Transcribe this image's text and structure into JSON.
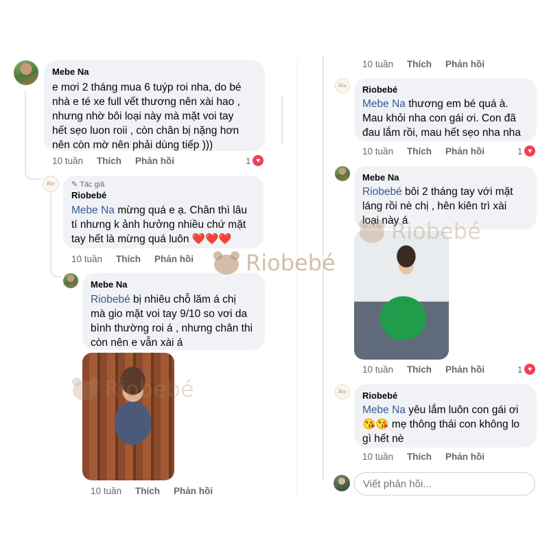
{
  "watermark": {
    "brand": "Riobebé"
  },
  "left": {
    "comment1": {
      "author": "Mebe Na",
      "text": "e mơi 2 tháng mua 6 tuýp roi nha, do bé\nnhà e té xe full vết thương nên xài hao ,\nnhưng nhờ bôi loại này mà mặt voi tay\nhết sẹo luon roii , còn chân bị nặng hơn\nnên còn mờ nên phải dùng tiếp )))",
      "time": "10 tuần",
      "like": "Thích",
      "reply": "Phản hồi",
      "reaction_count": "1"
    },
    "reply1": {
      "badge": "Tác giả",
      "author": "Riobebé",
      "mention": "Mebe Na",
      "text": " mừng quá e ạ. Chân thì lâu\ntí nhưng k ảnh hưởng nhiều chứ mặt\ntay hết là mừng quá luôn ❤️❤️❤️",
      "time": "10 tuần",
      "like": "Thích",
      "reply": "Phản hồi"
    },
    "reply2": {
      "author": "Mebe Na",
      "mention": "Riobebé",
      "text": " bị nhiêu chỗ lăm á chị\nmà gio mặt voi tay 9/10 so vơi da\nbình thường roi á , nhưng chân thi\ncòn nên e vẫn xài á",
      "time": "10 tuần",
      "like": "Thích",
      "reply": "Phản hồi"
    }
  },
  "right": {
    "top_actions": {
      "time": "10 tuần",
      "like": "Thích",
      "reply": "Phản hồi"
    },
    "reply3": {
      "author": "Riobebé",
      "mention": "Mebe Na",
      "text": " thương em bé quá à.\nMau khỏi nha con gái ơi. Con đã\nđau lắm rồi, mau hết sẹo nha nha",
      "time": "10 tuần",
      "like": "Thích",
      "reply": "Phản hồi",
      "reaction_count": "1"
    },
    "reply4": {
      "author": "Mebe Na",
      "mention": "Riobebé",
      "text": " bôi 2 tháng tay với mặt\nláng rồi nè chị , hên kiên trì xài\nloại này á",
      "time": "10 tuần",
      "like": "Thích",
      "reply": "Phản hồi",
      "reaction_count": "1"
    },
    "reply5": {
      "author": "Riobebé",
      "mention": "Mebe Na",
      "text": " yêu lắm luôn con gái ơi\n😘😘 mẹ thông thái con không lo\ngì hết nè",
      "time": "10 tuần",
      "like": "Thích",
      "reply": "Phản hồi"
    },
    "reply_input": {
      "placeholder": "Viết phản hồi..."
    }
  }
}
